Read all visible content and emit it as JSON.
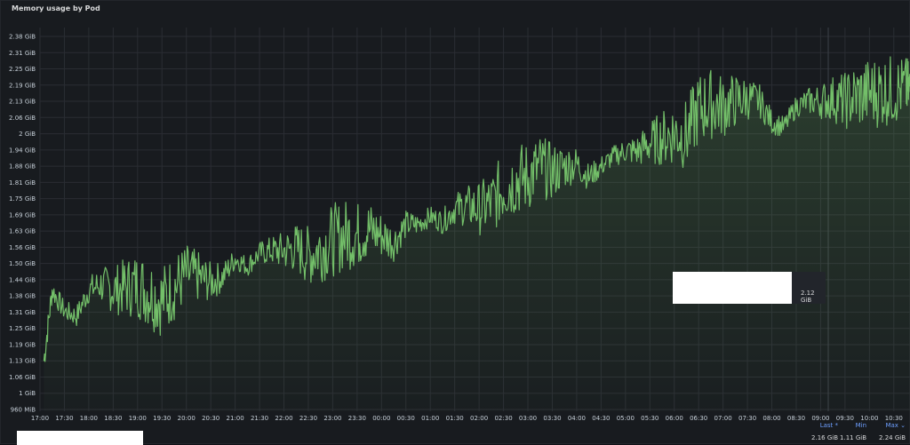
{
  "panel": {
    "title": "Memory usage by Pod"
  },
  "tooltip": {
    "value": "2.12 GiB"
  },
  "legend": {
    "headers": {
      "last": "Last *",
      "min": "Min",
      "max": "Max ⌄"
    },
    "values": {
      "last": "2.16 GiB",
      "min": "1.11 GiB",
      "max": "2.24 GiB"
    }
  },
  "colors": {
    "line": "#73bf69",
    "grid": "#2a2d33",
    "background": "#181b1f"
  },
  "chart_data": {
    "type": "area",
    "title": "Memory usage by Pod",
    "xlabel": "",
    "ylabel": "",
    "y_ticks": [
      "960 MiB",
      "1 GiB",
      "1.06 GiB",
      "1.13 GiB",
      "1.19 GiB",
      "1.25 GiB",
      "1.31 GiB",
      "1.38 GiB",
      "1.44 GiB",
      "1.50 GiB",
      "1.56 GiB",
      "1.63 GiB",
      "1.69 GiB",
      "1.75 GiB",
      "1.81 GiB",
      "1.88 GiB",
      "1.94 GiB",
      "2 GiB",
      "2.06 GiB",
      "2.13 GiB",
      "2.19 GiB",
      "2.25 GiB",
      "2.31 GiB",
      "2.38 GiB"
    ],
    "x_ticks": [
      "17:00",
      "17:30",
      "18:00",
      "18:30",
      "19:00",
      "19:30",
      "20:00",
      "20:30",
      "21:00",
      "21:30",
      "22:00",
      "22:30",
      "23:00",
      "23:30",
      "00:00",
      "00:30",
      "01:00",
      "01:30",
      "02:00",
      "02:30",
      "03:00",
      "03:30",
      "04:00",
      "04:30",
      "05:00",
      "05:30",
      "06:00",
      "06:30",
      "07:00",
      "07:30",
      "08:00",
      "08:30",
      "09:00",
      "09:30",
      "10:00",
      "10:30"
    ],
    "ylim_gib": [
      0.9375,
      2.4
    ],
    "x_hours_range": [
      17.0,
      34.85
    ],
    "grid": true,
    "series": [
      {
        "values_gib": [
          [
            17.08,
            1.13
          ],
          [
            17.25,
            1.4
          ],
          [
            17.5,
            1.32
          ],
          [
            17.75,
            1.3
          ],
          [
            18.0,
            1.4
          ],
          [
            18.25,
            1.42
          ],
          [
            18.5,
            1.4
          ],
          [
            18.75,
            1.41
          ],
          [
            19.0,
            1.42
          ],
          [
            19.25,
            1.39
          ],
          [
            19.5,
            1.36
          ],
          [
            19.75,
            1.41
          ],
          [
            20.0,
            1.46
          ],
          [
            20.25,
            1.45
          ],
          [
            20.5,
            1.43
          ],
          [
            20.75,
            1.45
          ],
          [
            21.0,
            1.52
          ],
          [
            21.25,
            1.49
          ],
          [
            21.5,
            1.54
          ],
          [
            21.75,
            1.55
          ],
          [
            22.0,
            1.55
          ],
          [
            22.25,
            1.56
          ],
          [
            22.5,
            1.53
          ],
          [
            22.75,
            1.56
          ],
          [
            23.0,
            1.59
          ],
          [
            23.25,
            1.61
          ],
          [
            23.5,
            1.61
          ],
          [
            23.75,
            1.63
          ],
          [
            24.0,
            1.61
          ],
          [
            24.25,
            1.58
          ],
          [
            24.5,
            1.65
          ],
          [
            24.75,
            1.65
          ],
          [
            25.0,
            1.68
          ],
          [
            25.25,
            1.66
          ],
          [
            25.5,
            1.71
          ],
          [
            25.75,
            1.72
          ],
          [
            26.0,
            1.71
          ],
          [
            26.25,
            1.73
          ],
          [
            26.5,
            1.79
          ],
          [
            26.75,
            1.82
          ],
          [
            27.0,
            1.83
          ],
          [
            27.25,
            1.87
          ],
          [
            27.5,
            1.85
          ],
          [
            27.75,
            1.87
          ],
          [
            28.0,
            1.88
          ],
          [
            28.25,
            1.83
          ],
          [
            28.5,
            1.87
          ],
          [
            28.75,
            1.91
          ],
          [
            29.0,
            1.93
          ],
          [
            29.25,
            1.93
          ],
          [
            29.5,
            1.96
          ],
          [
            29.75,
            1.98
          ],
          [
            30.0,
            2.0
          ],
          [
            30.25,
            1.99
          ],
          [
            30.5,
            2.09
          ],
          [
            30.75,
            2.11
          ],
          [
            31.0,
            2.1
          ],
          [
            31.25,
            2.12
          ],
          [
            31.5,
            2.13
          ],
          [
            31.75,
            2.12
          ],
          [
            32.0,
            2.04
          ],
          [
            32.25,
            2.02
          ],
          [
            32.5,
            2.1
          ],
          [
            32.75,
            2.12
          ],
          [
            33.0,
            2.12
          ],
          [
            33.25,
            2.13
          ],
          [
            33.5,
            2.12
          ],
          [
            33.75,
            2.14
          ],
          [
            34.0,
            2.15
          ],
          [
            34.25,
            2.16
          ],
          [
            34.5,
            2.16
          ],
          [
            34.75,
            2.17
          ],
          [
            34.85,
            2.16
          ]
        ]
      }
    ]
  }
}
